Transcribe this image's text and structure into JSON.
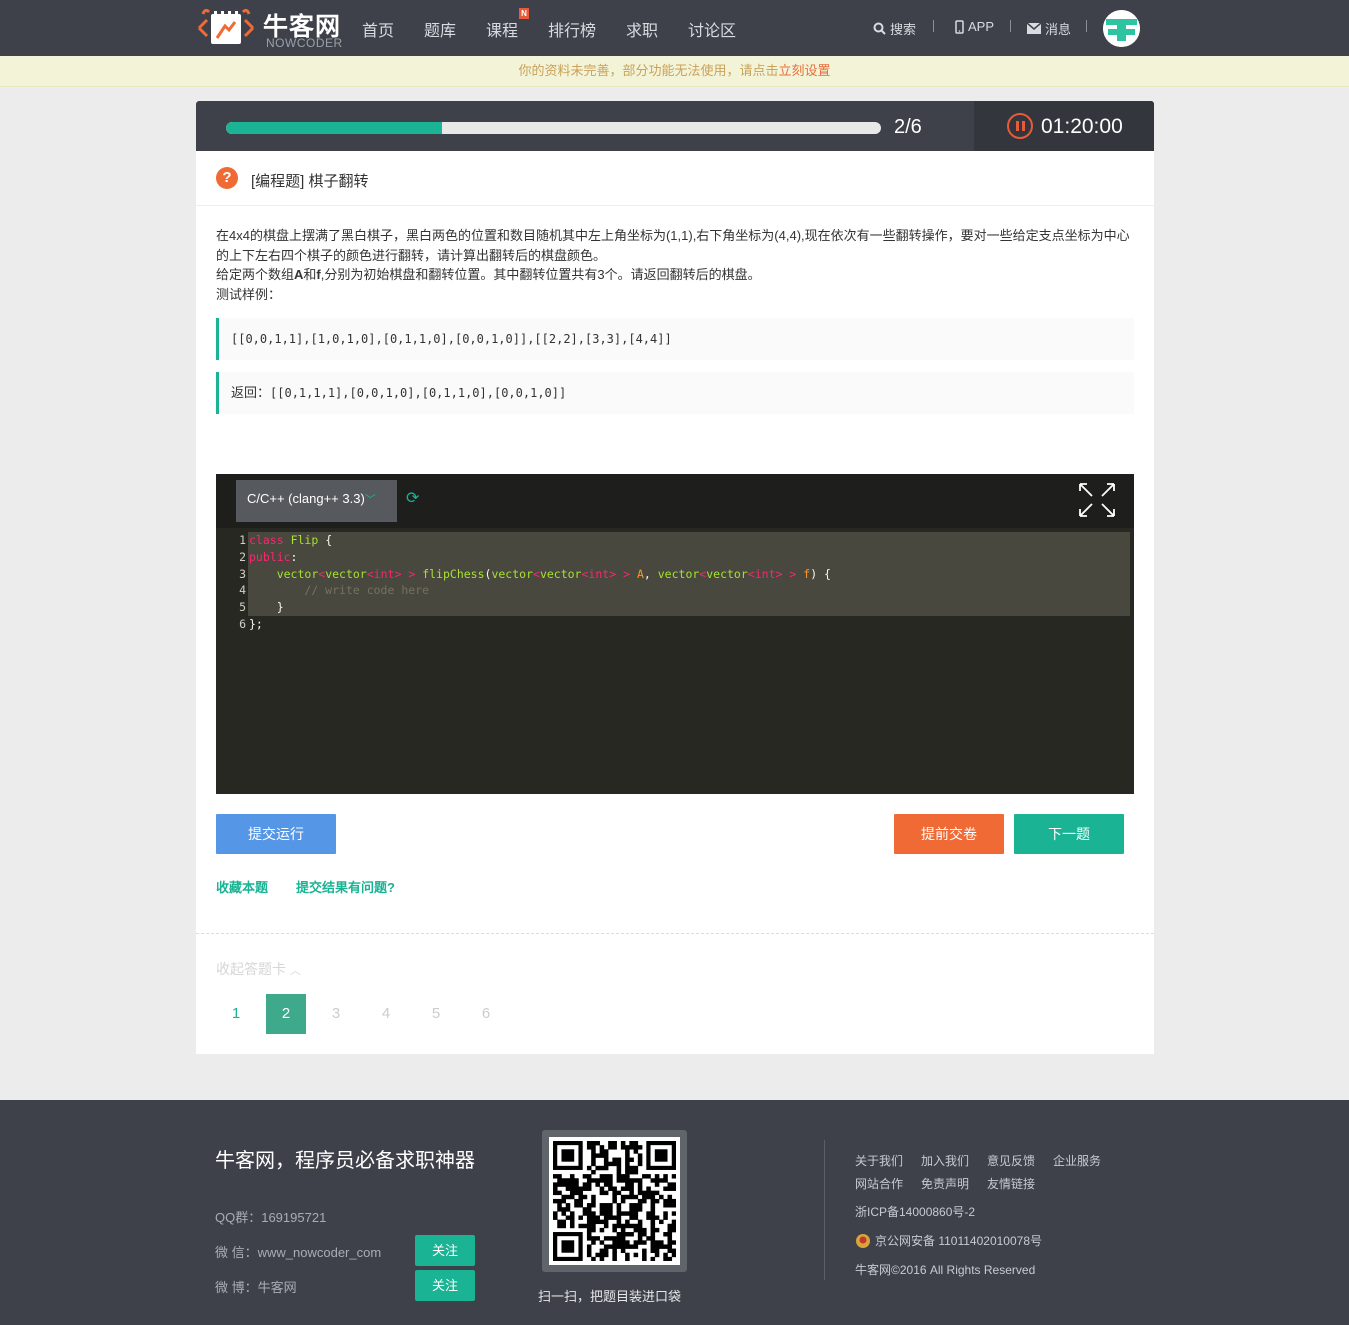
{
  "nav": {
    "logo_cn": "牛客网",
    "logo_en": "NOWCODER",
    "items": [
      "首页",
      "题库",
      "课程",
      "排行榜",
      "求职",
      "讨论区"
    ],
    "new_badge": "N",
    "search": "搜索",
    "app": "APP",
    "messages": "消息"
  },
  "notice": {
    "text": "你的资料未完善，部分功能无法使用，请点击",
    "link": "立刻设置"
  },
  "progress": {
    "count": "2/6",
    "fraction": 0.33,
    "timer": "01:20:00"
  },
  "question": {
    "icon": "?",
    "title": "[编程题] 棋子翻转",
    "desc_line1": "在4x4的棋盘上摆满了黑白棋子，黑白两色的位置和数目随机其中左上角坐标为(1,1),右下角坐标为(4,4),现在依次有一些翻转操作，要对一些给定支点坐标为中心的上下左右四个棋子的颜色进行翻转，请计算出翻转后的棋盘颜色。",
    "desc_line2_a": "给定两个数组",
    "desc_line2_A": "A",
    "desc_line2_and": "和",
    "desc_line2_f": "f",
    "desc_line2_b": ",分别为初始棋盘和翻转位置。其中翻转位置共有3个。请返回翻转后的棋盘。",
    "desc_line3": "测试样例：",
    "sample_input": "[[0,0,1,1],[1,0,1,0],[0,1,1,0],[0,0,1,0]],[[2,2],[3,3],[4,4]]",
    "sample_output_label": "返回：",
    "sample_output": "[[0,1,1,1],[0,0,1,0],[0,1,1,0],[0,0,1,0]]"
  },
  "editor": {
    "language": "C/C++ (clang++ 3.3)",
    "line_numbers": [
      "1",
      "2",
      "3",
      "4",
      "5",
      "6"
    ]
  },
  "actions": {
    "submit": "提交运行",
    "early_submit": "提前交卷",
    "next": "下一题",
    "favorite": "收藏本题",
    "report": "提交结果有问题?",
    "collapse_card": "收起答题卡",
    "question_numbers": [
      "1",
      "2",
      "3",
      "4",
      "5",
      "6"
    ]
  },
  "footer": {
    "slogan": "牛客网，程序员必备求职神器",
    "qq": "QQ群：169195721",
    "wechat": "微 信：www_nowcoder_com",
    "weibo": "微 博：牛客网",
    "follow": "关注",
    "qr_caption": "扫一扫，把题目装进口袋",
    "links_row1": [
      "关于我们",
      "加入我们",
      "意见反馈",
      "企业服务"
    ],
    "links_row2": [
      "网站合作",
      "免责声明",
      "友情链接"
    ],
    "icp": "浙ICP备14000860号-2",
    "police": "京公网安备 11011402010078号",
    "copyright": "牛客网©2016 All Rights Reserved"
  },
  "colors": {
    "nav_bg": "#3e4149",
    "accent": "#1ab394",
    "orange": "#f06a35",
    "blue": "#5596e6",
    "editor_bg": "#272822"
  }
}
